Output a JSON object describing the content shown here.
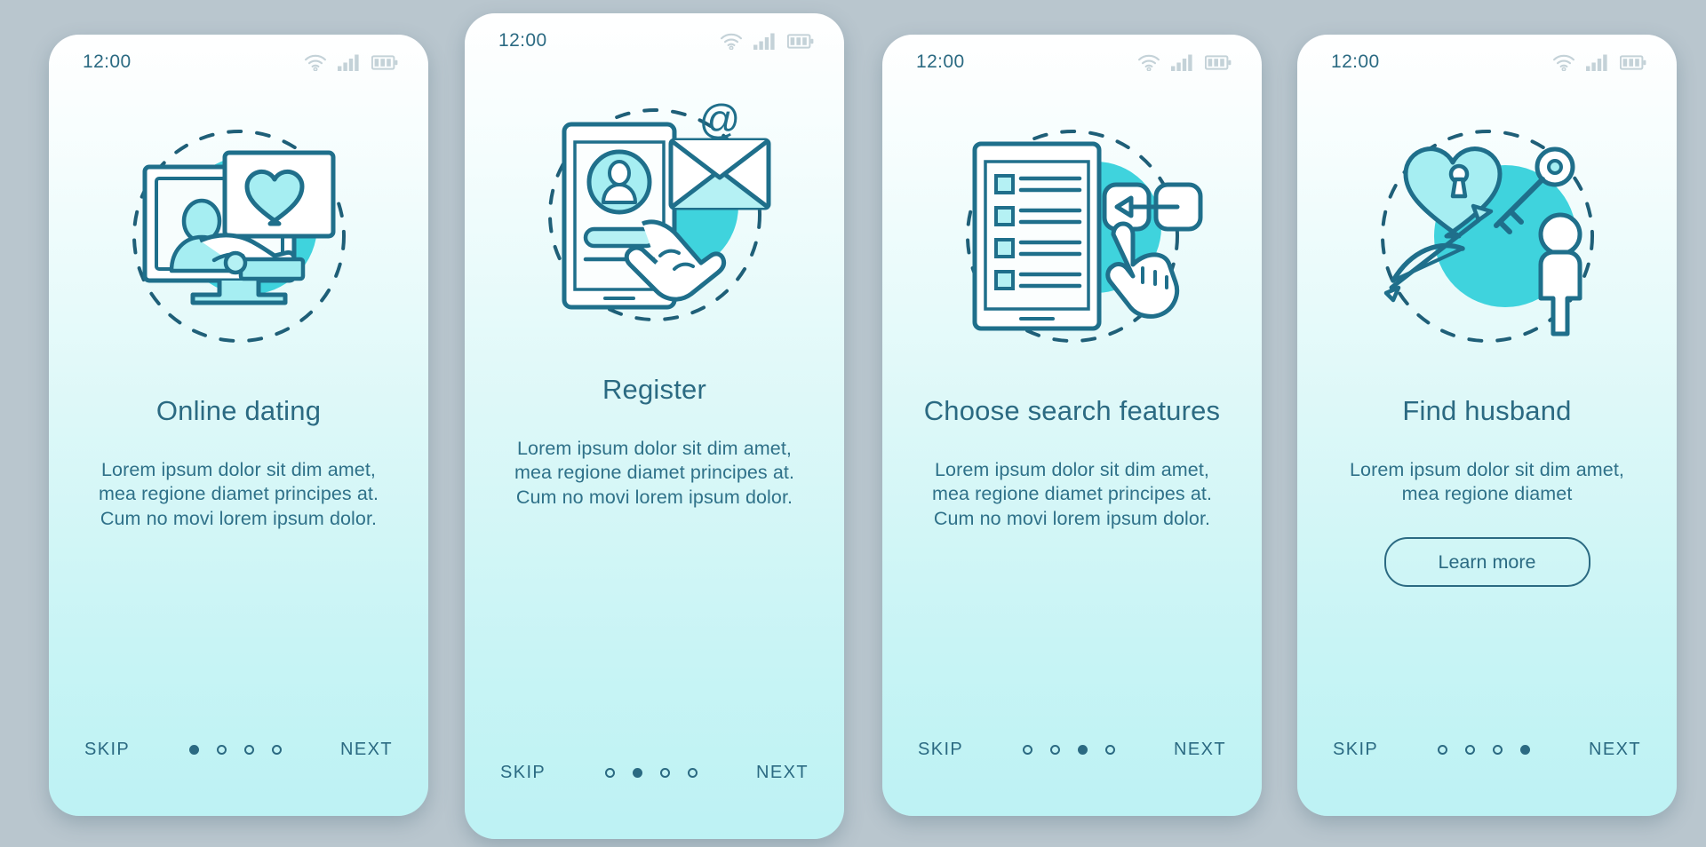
{
  "meta": {
    "background_color": "#b9c6ce",
    "accent_color": "#3fd3dd",
    "line_color": "#2b6a82",
    "text_color": "#2b6a82"
  },
  "status_bar": {
    "time": "12:00",
    "icons": [
      "wifi-icon",
      "cellular-signal-icon",
      "battery-icon"
    ]
  },
  "screens": [
    {
      "id": "online-dating",
      "illustration": "monitor-profile-heart-illustration",
      "title": "Online dating",
      "body": "Lorem ipsum dolor sit dim amet, mea regione diamet principes at. Cum no movi lorem ipsum dolor.",
      "skip_label": "SKIP",
      "next_label": "NEXT",
      "dots": 4,
      "active_dot": 1,
      "has_learn_more": false,
      "learn_more_label": ""
    },
    {
      "id": "register",
      "illustration": "phone-profile-email-illustration",
      "title": "Register",
      "body": "Lorem ipsum dolor sit dim amet, mea regione diamet principes at. Cum no movi lorem ipsum dolor.",
      "skip_label": "SKIP",
      "next_label": "NEXT",
      "dots": 4,
      "active_dot": 2,
      "has_learn_more": false,
      "learn_more_label": ""
    },
    {
      "id": "choose-search-features",
      "illustration": "checklist-tablet-cursor-illustration",
      "title": "Choose search features",
      "body": "Lorem ipsum dolor sit dim amet, mea regione diamet principes at. Cum no movi lorem ipsum dolor.",
      "skip_label": "SKIP",
      "next_label": "NEXT",
      "dots": 4,
      "active_dot": 3,
      "has_learn_more": false,
      "learn_more_label": ""
    },
    {
      "id": "find-husband",
      "illustration": "heart-lock-key-cupid-illustration",
      "title": "Find husband",
      "body": "Lorem ipsum dolor sit dim amet, mea regione diamet",
      "skip_label": "SKIP",
      "next_label": "NEXT",
      "dots": 4,
      "active_dot": 4,
      "has_learn_more": true,
      "learn_more_label": "Learn more"
    }
  ]
}
